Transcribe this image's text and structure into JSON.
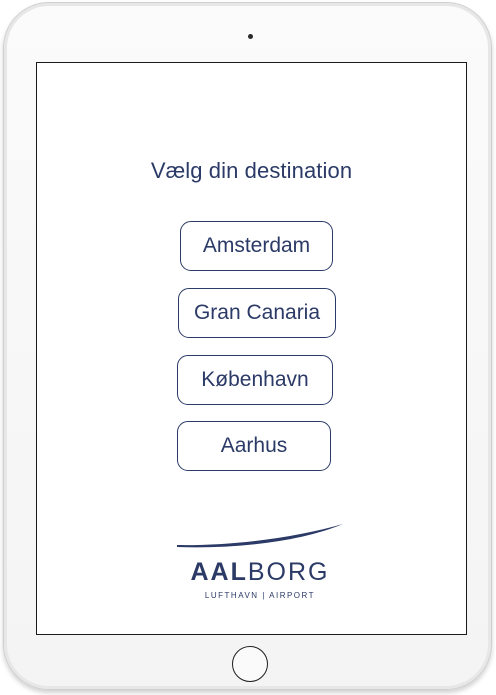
{
  "screen": {
    "title": "Vælg din destination",
    "destinations": [
      {
        "label": "Amsterdam"
      },
      {
        "label": "Gran Canaria"
      },
      {
        "label": "København"
      },
      {
        "label": "Aarhus"
      }
    ]
  },
  "logo": {
    "word_bold": "AAL",
    "word_light": "BORG",
    "subtitle": "LUFTHAVN | AIRPORT"
  },
  "colors": {
    "accent": "#2b3a66",
    "screen_background": "#ffffff",
    "device_frame": "#f4f4f4"
  }
}
